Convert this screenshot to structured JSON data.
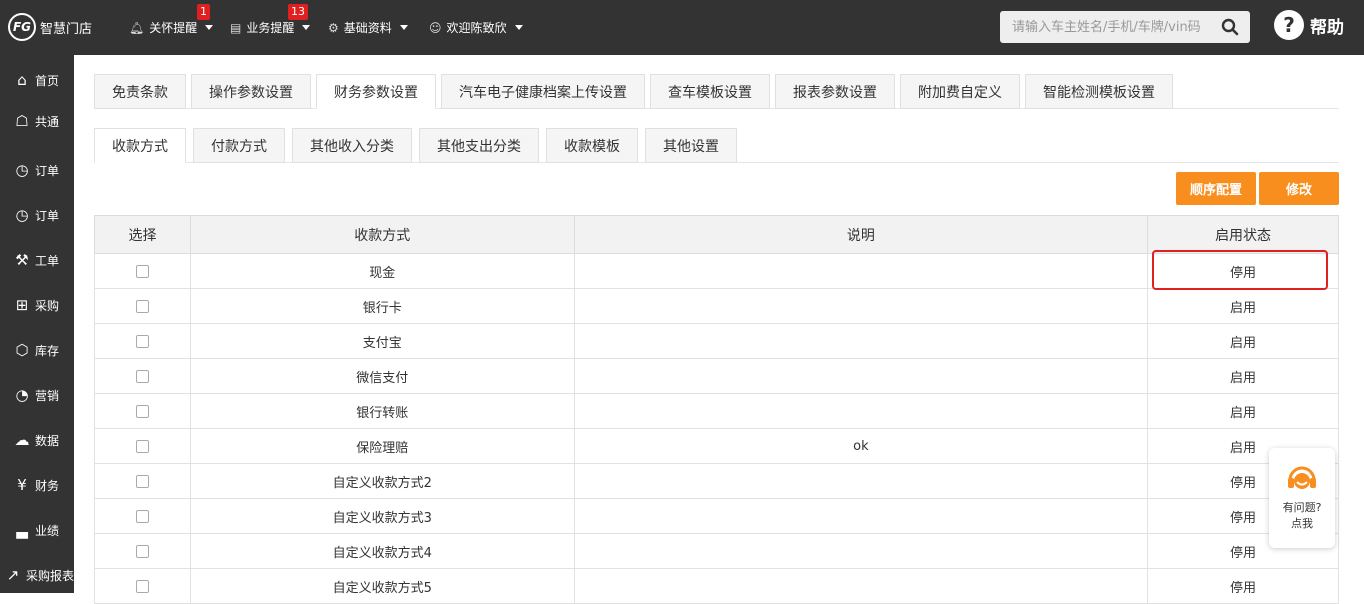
{
  "brand": {
    "logo_mark": "FG",
    "name": "智慧门店"
  },
  "topbar": {
    "menus": [
      {
        "label": "关怀提醒",
        "icon": "bell-icon",
        "badge": "1"
      },
      {
        "label": "业务提醒",
        "icon": "document-icon",
        "badge": "13"
      },
      {
        "label": "基础资料",
        "icon": "gear-icon",
        "badge": ""
      },
      {
        "label": "欢迎陈致欣",
        "icon": "user-icon",
        "badge": ""
      }
    ],
    "search_placeholder": "请输入车主姓名/手机/车牌/vin码",
    "help_label": "帮助"
  },
  "sidebar": {
    "items": [
      {
        "label": "首页",
        "icon": "home-icon"
      },
      {
        "label": "共通",
        "icon": "house-icon"
      },
      {
        "label": "订单",
        "icon": "history-icon"
      },
      {
        "label": "订单",
        "icon": "history-icon"
      },
      {
        "label": "工单",
        "icon": "wrench-icon"
      },
      {
        "label": "采购",
        "icon": "cart-icon"
      },
      {
        "label": "库存",
        "icon": "box-icon"
      },
      {
        "label": "营销",
        "icon": "pie-icon"
      },
      {
        "label": "数据",
        "icon": "cloud-icon"
      },
      {
        "label": "财务",
        "icon": "yen-icon"
      },
      {
        "label": "业绩",
        "icon": "bar-chart-icon"
      },
      {
        "label": "采购报表",
        "icon": "line-chart-icon"
      }
    ]
  },
  "tabs_primary": [
    "免责条款",
    "操作参数设置",
    "财务参数设置",
    "汽车电子健康档案上传设置",
    "查车模板设置",
    "报表参数设置",
    "附加费自定义",
    "智能检测模板设置"
  ],
  "tabs_primary_active": 2,
  "tabs_secondary": [
    "收款方式",
    "付款方式",
    "其他收入分类",
    "其他支出分类",
    "收款模板",
    "其他设置"
  ],
  "tabs_secondary_active": 0,
  "buttons": {
    "order_config": "顺序配置",
    "edit": "修改"
  },
  "table": {
    "headers": [
      "选择",
      "收款方式",
      "说明",
      "启用状态"
    ],
    "rows": [
      {
        "method": "现金",
        "note": "",
        "status": "停用"
      },
      {
        "method": "银行卡",
        "note": "",
        "status": "启用"
      },
      {
        "method": "支付宝",
        "note": "",
        "status": "启用"
      },
      {
        "method": "微信支付",
        "note": "",
        "status": "启用"
      },
      {
        "method": "银行转账",
        "note": "",
        "status": "启用"
      },
      {
        "method": "保险理赔",
        "note": "ok",
        "status": "启用"
      },
      {
        "method": "自定义收款方式2",
        "note": "",
        "status": "停用"
      },
      {
        "method": "自定义收款方式3",
        "note": "",
        "status": "停用"
      },
      {
        "method": "自定义收款方式4",
        "note": "",
        "status": "停用"
      },
      {
        "method": "自定义收款方式5",
        "note": "",
        "status": "停用"
      }
    ]
  },
  "float_help": {
    "line1": "有问题?",
    "line2": "点我"
  },
  "colors": {
    "topbar": "#333333",
    "accent": "#f78e1e",
    "highlight": "#e02020"
  }
}
